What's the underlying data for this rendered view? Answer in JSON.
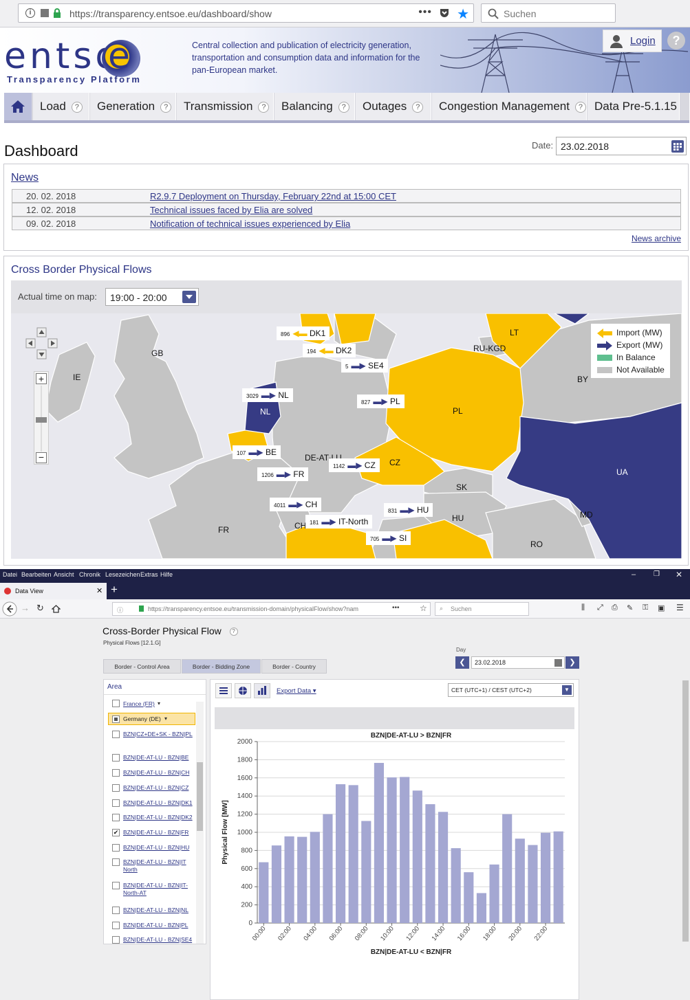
{
  "browser_top": {
    "url": "https://transparency.entsoe.eu/dashboard/show",
    "search_placeholder": "Suchen"
  },
  "header": {
    "logo_text": "entso",
    "logo_e": "e",
    "logo_sub": "Transparency Platform",
    "description": "Central collection and publication of electricity generation, transportation and consumption data and information for the pan-European market.",
    "login": "Login",
    "help": "?"
  },
  "nav": {
    "items": [
      "Load",
      "Generation",
      "Transmission",
      "Balancing",
      "Outages",
      "Congestion Management",
      "Data Pre-5.1.15"
    ]
  },
  "dashboard": {
    "title": "Dashboard",
    "date_label": "Date:",
    "date_value": "23.02.2018"
  },
  "news": {
    "title": "News",
    "rows": [
      {
        "date": "20. 02. 2018",
        "text": "R2.9.7 Deployment on Thursday, February 22nd at 15:00 CET"
      },
      {
        "date": "12. 02. 2018",
        "text": "Technical issues faced by Elia are solved"
      },
      {
        "date": "09. 02. 2018",
        "text": "Notification of technical issues experienced by Elia"
      }
    ],
    "archive": "News archive"
  },
  "flows": {
    "title": "Cross Border Physical Flows",
    "time_label": "Actual time on map:",
    "time_value": "19:00 - 20:00",
    "legend": [
      "Import (MW)",
      "Export (MW)",
      "In Balance",
      "Not Available"
    ],
    "colors": {
      "import": "#f9c000",
      "export": "#363b84",
      "balance": "#5fbf8f",
      "na": "#c4c4c4"
    },
    "countries": [
      "DK1",
      "DK2",
      "LT",
      "RU-KGD",
      "GB",
      "IE",
      "BY",
      "PL",
      "NL",
      "BE",
      "DE-AT-LU",
      "CZ",
      "UA",
      "SK",
      "FR",
      "CH",
      "HU",
      "MD",
      "RO",
      "IT-NORTH"
    ],
    "tags": [
      {
        "value": "896",
        "label": "DK1",
        "dir": "import"
      },
      {
        "value": "194",
        "label": "DK2",
        "dir": "import"
      },
      {
        "value": "5",
        "label": "SE4",
        "dir": "export"
      },
      {
        "value": "3029",
        "label": "NL",
        "dir": "export"
      },
      {
        "value": "827",
        "label": "PL",
        "dir": "export"
      },
      {
        "value": "107",
        "label": "BE",
        "dir": "export"
      },
      {
        "value": "1142",
        "label": "CZ",
        "dir": "export"
      },
      {
        "value": "1206",
        "label": "FR",
        "dir": "export"
      },
      {
        "value": "4011",
        "label": "CH",
        "dir": "export"
      },
      {
        "value": "181",
        "label": "IT-North",
        "dir": "export"
      },
      {
        "value": "831",
        "label": "HU",
        "dir": "export"
      },
      {
        "value": "705",
        "label": "SI",
        "dir": "export"
      }
    ]
  },
  "browser2": {
    "menu": [
      "Datei",
      "Bearbeiten",
      "Ansicht",
      "Chronik",
      "Lesezeichen",
      "Extras",
      "Hilfe"
    ],
    "tab_title": "Data View",
    "url": "https://transparency.entsoe.eu/transmission-domain/physicalFlow/show?nam",
    "search_placeholder": "Suchen"
  },
  "dataview": {
    "title": "Cross-Border Physical Flow",
    "subtitle": "Physical Flows [12.1.G]",
    "tabs": [
      "Border - Control Area",
      "Border - Bidding Zone",
      "Border - Country"
    ],
    "day_label": "Day",
    "day_value": "23.02.2018",
    "area_title": "Area",
    "areas": [
      {
        "label": "France (FR)",
        "checked": false
      },
      {
        "label": "Germany (DE)",
        "checked": true
      },
      {
        "label": "BZN|CZ+DE+SK - BZN|PL",
        "checked": false
      },
      {
        "label": "BZN|DE-AT-LU - BZN|BE",
        "checked": false
      },
      {
        "label": "BZN|DE-AT-LU - BZN|CH",
        "checked": false
      },
      {
        "label": "BZN|DE-AT-LU - BZN|CZ",
        "checked": false
      },
      {
        "label": "BZN|DE-AT-LU - BZN|DK1",
        "checked": false
      },
      {
        "label": "BZN|DE-AT-LU - BZN|DK2",
        "checked": false
      },
      {
        "label": "BZN|DE-AT-LU - BZN|FR",
        "checked": true
      },
      {
        "label": "BZN|DE-AT-LU - BZN|HU",
        "checked": false
      },
      {
        "label": "BZN|DE-AT-LU - BZN|IT North",
        "checked": false
      },
      {
        "label": "BZN|DE-AT-LU - BZN|IT-North-AT",
        "checked": false
      },
      {
        "label": "BZN|DE-AT-LU - BZN|NL",
        "checked": false
      },
      {
        "label": "BZN|DE-AT-LU - BZN|PL",
        "checked": false
      },
      {
        "label": "BZN|DE-AT-LU - BZN|SE4",
        "checked": false
      }
    ],
    "export_label": "Export Data",
    "timezone": "CET (UTC+1) / CEST (UTC+2)"
  },
  "chart_data": {
    "type": "bar",
    "title": "BZN|DE-AT-LU > BZN|FR",
    "xlabel": "BZN|DE-AT-LU < BZN|FR",
    "ylabel": "Physical Flow [MW]",
    "ylim": [
      0,
      2000
    ],
    "yticks": [
      0,
      200,
      400,
      600,
      800,
      1000,
      1200,
      1400,
      1600,
      1800,
      2000
    ],
    "xtick_labels": [
      "00:00",
      "02:00",
      "04:00",
      "06:00",
      "08:00",
      "10:00",
      "12:00",
      "14:00",
      "16:00",
      "18:00",
      "20:00",
      "22:00"
    ],
    "categories": [
      "00:00",
      "01:00",
      "02:00",
      "03:00",
      "04:00",
      "05:00",
      "06:00",
      "07:00",
      "08:00",
      "09:00",
      "10:00",
      "11:00",
      "12:00",
      "13:00",
      "14:00",
      "15:00",
      "16:00",
      "17:00",
      "18:00",
      "19:00",
      "20:00",
      "21:00",
      "22:00",
      "23:00"
    ],
    "values": [
      670,
      855,
      955,
      950,
      1005,
      1200,
      1530,
      1520,
      1125,
      1765,
      1605,
      1610,
      1460,
      1310,
      1225,
      825,
      560,
      330,
      645,
      1200,
      930,
      860,
      995,
      1010
    ],
    "bar_color": "#a4a7d2",
    "grid": true
  }
}
